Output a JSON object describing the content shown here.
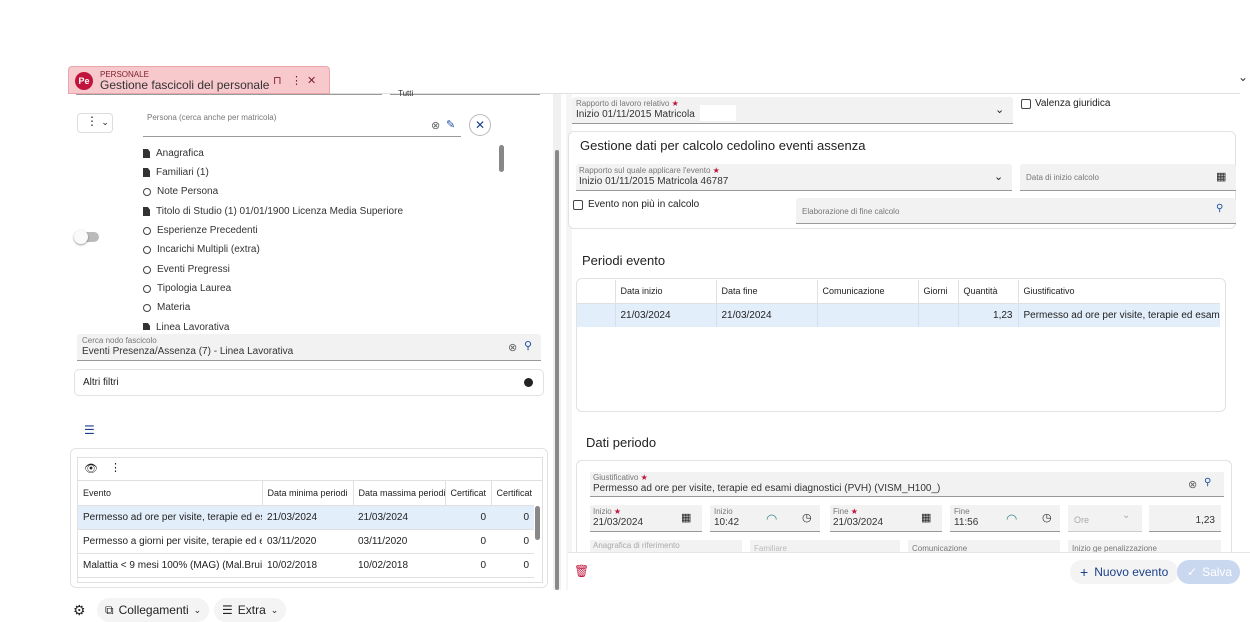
{
  "tab": {
    "logo": "Pe",
    "category": "PERSONALE",
    "title": "Gestione fascicoli del personale"
  },
  "left": {
    "top_field_value": "Tutti",
    "person_label": "Persona (cerca anche per matricola)",
    "tree_items": [
      {
        "label": "Anagrafica",
        "icon": "doc"
      },
      {
        "label": "Familiari (1)",
        "icon": "doc"
      },
      {
        "label": "Note Persona",
        "icon": "circle"
      },
      {
        "label": "Titolo di Studio (1) 01/01/1900  Licenza Media Superiore",
        "icon": "doc"
      },
      {
        "label": "Esperienze Precedenti",
        "icon": "circle"
      },
      {
        "label": "Incarichi Multipli (extra)",
        "icon": "circle"
      },
      {
        "label": "Eventi Pregressi",
        "icon": "circle"
      },
      {
        "label": "Tipologia Laurea",
        "icon": "circle"
      },
      {
        "label": "Materia",
        "icon": "circle"
      },
      {
        "label": "Linea Lavorativa",
        "icon": "doc"
      }
    ],
    "search_node_label": "Cerca nodo fascicolo",
    "search_node_value": "Eventi Presenza/Assenza (7) - Linea Lavorativa",
    "other_filters": "Altri filtri",
    "table": {
      "headers": [
        "Evento",
        "Data minima periodi",
        "Data massima periodi",
        "Certificat",
        "Certificat"
      ],
      "rows": [
        [
          "Permesso ad ore per visite, terapie ed es",
          "21/03/2024",
          "21/03/2024",
          "0",
          "0"
        ],
        [
          "Permesso a giorni per visite, terapie ed e",
          "03/11/2020",
          "03/11/2020",
          "0",
          "0"
        ],
        [
          "Malattia < 9 mesi 100% (MAG) (Mal.Brui",
          "10/02/2018",
          "10/02/2018",
          "0",
          "0"
        ]
      ]
    }
  },
  "right": {
    "rapporto_label": "Rapporto di lavoro relativo",
    "rapporto_value": "Inizio 01/11/2015 Matricola",
    "valenza": "Valenza giuridica",
    "section_title": "Gestione dati per calcolo cedolino eventi assenza",
    "rapporto_evento_label": "Rapporto sul quale applicare l'evento",
    "rapporto_evento_value": "Inizio 01/11/2015 Matricola 46787",
    "data_inizio_calcolo": "Data di inizio calcolo",
    "evento_non_piu": "Evento non più in calcolo",
    "elaborazione": "Elaborazione di fine calcolo",
    "periodi_title": "Periodi evento",
    "periodi_headers": [
      "Data inizio",
      "Data fine",
      "Comunicazione",
      "Giorni",
      "Quantità",
      "Giustificativo"
    ],
    "periodi_row": [
      "21/03/2024",
      "21/03/2024",
      "",
      "",
      "1,23",
      "Permesso ad ore per visite, terapie ed esam"
    ],
    "dati_title": "Dati periodo",
    "giustificativo_label": "Giustificativo",
    "giustificativo_value": "Permesso ad ore per visite, terapie ed esami diagnostici (PVH) (VISM_H100_)",
    "inizio_label": "Inizio",
    "inizio_date": "21/03/2024",
    "inizio_time_label": "Inizio",
    "inizio_time": "10:42",
    "fine_label": "Fine",
    "fine_date": "21/03/2024",
    "fine_time_label": "Fine",
    "fine_time": "11:56",
    "unit": "Ore",
    "quantity": "1,23",
    "anagrafica_rif": "Anagrafica di riferimento",
    "familiare": "Familiare",
    "comunicazione": "Comunicazione",
    "inizio_penalizzazione": "Inizio ge penalizzazione",
    "nuovo_evento": "Nuovo evento",
    "salva": "Salva"
  },
  "bottom": {
    "collegamenti": "Collegamenti",
    "extra": "Extra"
  },
  "colors": {
    "accent": "#c0143c",
    "tab_bg": "#f8c9cc",
    "selected_row": "#e3eefb",
    "save_btn": "#c9d7ef"
  }
}
